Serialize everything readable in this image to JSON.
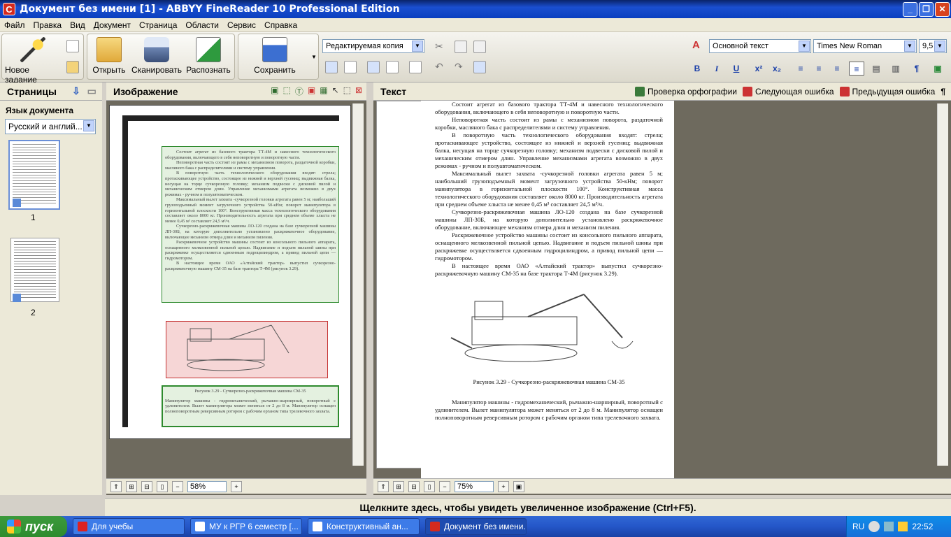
{
  "window": {
    "title": "Документ без имени [1] - ABBYY FineReader 10 Professional Edition"
  },
  "menu": [
    "Файл",
    "Правка",
    "Вид",
    "Документ",
    "Страница",
    "Области",
    "Сервис",
    "Справка"
  ],
  "toolbar": {
    "new_task": "Новое задание",
    "open": "Открыть",
    "scan": "Сканировать",
    "recognize": "Распознать",
    "save": "Сохранить",
    "mode": "Редактируемая копия",
    "style": "Основной текст",
    "font": "Times New Roman",
    "size": "9,5"
  },
  "pages_pane": {
    "title": "Страницы",
    "lang_label": "Язык документа",
    "lang_value": "Русский и англий...",
    "pages": [
      "1",
      "2"
    ]
  },
  "image_pane": {
    "title": "Изображение",
    "zoom": "58%"
  },
  "text_pane": {
    "title": "Текст",
    "spellcheck": "Проверка орфографии",
    "next_error": "Следующая ошибка",
    "prev_error": "Предыдущая ошибка",
    "zoom": "75%",
    "paragraphs": [
      "Состоит агрегат из базового трактора ТТ-4М и навесного технологического оборудования, включающего в себя неповоротную и поворотную части.",
      "Неповоротная часть состоит из рамы с механизмом поворота, раздаточной коробки, масляного бака с распределителями и систему управления.",
      "В поворотную часть технологического оборудования входят: стрела; протаскивающее устройство, состоящее из нижней и верхней гусениц; выдвижная балка, несущая на торце сучкорезную головку; механизм подвески с дисковой пилой и механическим отмером длин. Управление механизмами агрегата возможно в двух режимах - ручном и полуавтоматическом.",
      "Максимальный вылет захвата -сучкорезной головки агрегата равен 5 м; наибольший грузоподъемный момент загрузочного устройства 50-кНм; поворот манипулятора в горизонтальной плоскости 100°. Конструктивная масса технологического оборудования составляет около 8000 кг. Производительность агрегата при среднем объеме хлыста не менее 0,45 м³ составляет 24,5 м³/ч.",
      "Сучкорезно-раскряжевочная машина ЛО-120 создана на базе сучкорезной машины ЛП-30Б, на которую дополнительно установлено раскряжевочное оборудование, включающее механизм отмера длин и механизм пиления.",
      "Раскряжевочное устройство машины состоит из консольного пильного аппарата, оснащенного мелкозвенной пильной цепью. Надвигание и подъем пильной шины при раскряжевке осуществляется сдвоенным гидроцилиндром, а привод пильной цепи — гидромотором.",
      "В настоящее время ОАО «Алтайский трактор» выпустил сучкорезно-раскряжевочную машину СМ-35 на базе трактора Т-4М (рисунок 3.29)."
    ],
    "caption": "Рисунок 3.29 - Сучкорезно-раскряжевочная машина СМ-35",
    "after": "Манипулятор машины - гидромеханический, рычажно-шарнирный, поворотный с удлинителем. Вылет манипулятора может меняться от 2 до 8 м. Манипулятор оснащен полноповоротным реверсивным ротором с рабочим органом типа трелевочного захвата."
  },
  "status": "Щелкните здесь, чтобы увидеть увеличенное изображение (Ctrl+F5).",
  "taskbar": {
    "start": "пуск",
    "tasks": [
      "Для учебы",
      "МУ к РГР 6 семестр [...",
      "Конструктивный ан...",
      "Документ без имени..."
    ],
    "lang": "RU",
    "clock": "22:52"
  }
}
